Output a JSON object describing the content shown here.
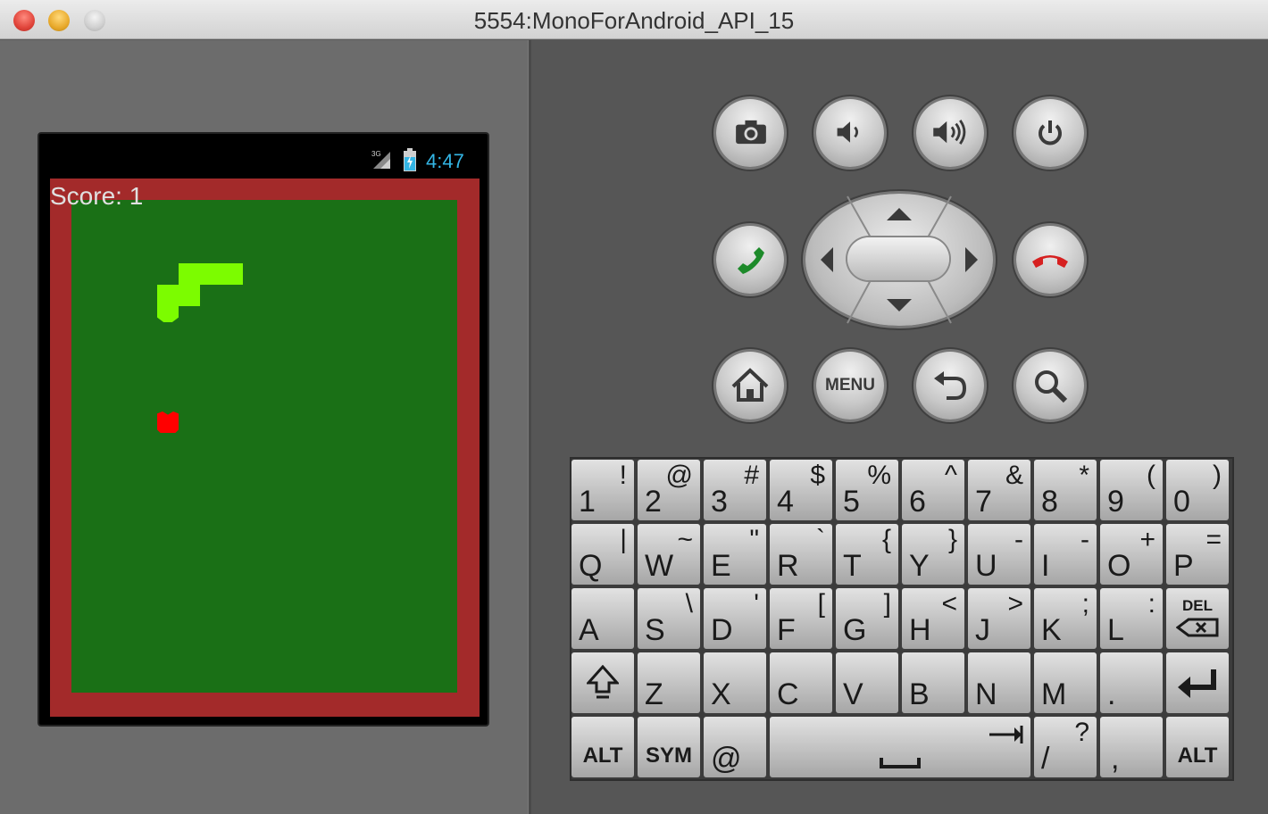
{
  "window": {
    "title": "5554:MonoForAndroid_API_15"
  },
  "status_bar": {
    "network": "3G",
    "time": "4:47",
    "signal_icon": "signal-3g-icon",
    "battery_icon": "battery-charging-icon"
  },
  "game": {
    "score_text": "Score: 1",
    "colors": {
      "wall": "#a32a2a",
      "field": "#1a7016",
      "snake": "#7cfc00",
      "food": "#ff0000"
    }
  },
  "hardware_buttons": {
    "row1": [
      "camera-icon",
      "volume-down-icon",
      "volume-up-icon",
      "power-icon"
    ],
    "row2": [
      "call-icon",
      "dpad",
      "end-call-icon"
    ],
    "row3": [
      "home-icon",
      "MENU",
      "back-icon",
      "search-icon"
    ]
  },
  "keyboard": {
    "row1": [
      {
        "k": "1",
        "a": "!"
      },
      {
        "k": "2",
        "a": "@"
      },
      {
        "k": "3",
        "a": "#"
      },
      {
        "k": "4",
        "a": "$"
      },
      {
        "k": "5",
        "a": "%"
      },
      {
        "k": "6",
        "a": "^"
      },
      {
        "k": "7",
        "a": "&"
      },
      {
        "k": "8",
        "a": "*"
      },
      {
        "k": "9",
        "a": "("
      },
      {
        "k": "0",
        "a": ")"
      }
    ],
    "row2": [
      {
        "k": "Q",
        "a": "|"
      },
      {
        "k": "W",
        "a": "~"
      },
      {
        "k": "E",
        "a": "\""
      },
      {
        "k": "R",
        "a": "`"
      },
      {
        "k": "T",
        "a": "{"
      },
      {
        "k": "Y",
        "a": "}"
      },
      {
        "k": "U",
        "a": "-"
      },
      {
        "k": "I",
        "a": "-"
      },
      {
        "k": "O",
        "a": "+"
      },
      {
        "k": "P",
        "a": "="
      }
    ],
    "row3": [
      {
        "k": "A",
        "a": ""
      },
      {
        "k": "S",
        "a": "\\"
      },
      {
        "k": "D",
        "a": "'"
      },
      {
        "k": "F",
        "a": "["
      },
      {
        "k": "G",
        "a": "]"
      },
      {
        "k": "H",
        "a": "<"
      },
      {
        "k": "J",
        "a": ">"
      },
      {
        "k": "K",
        "a": ";"
      },
      {
        "k": "L",
        "a": ":"
      }
    ],
    "row4": [
      {
        "k": "Z",
        "a": ""
      },
      {
        "k": "X",
        "a": ""
      },
      {
        "k": "C",
        "a": ""
      },
      {
        "k": "V",
        "a": ""
      },
      {
        "k": "B",
        "a": ""
      },
      {
        "k": "N",
        "a": ""
      },
      {
        "k": "M",
        "a": ""
      },
      {
        "k": ".",
        "a": ""
      }
    ],
    "row5": {
      "alt_left": "ALT",
      "sym": "SYM",
      "at": "@",
      "slash": "/",
      "question": "?",
      "comma": ",",
      "alt_right": "ALT"
    },
    "del_label": "DEL"
  }
}
